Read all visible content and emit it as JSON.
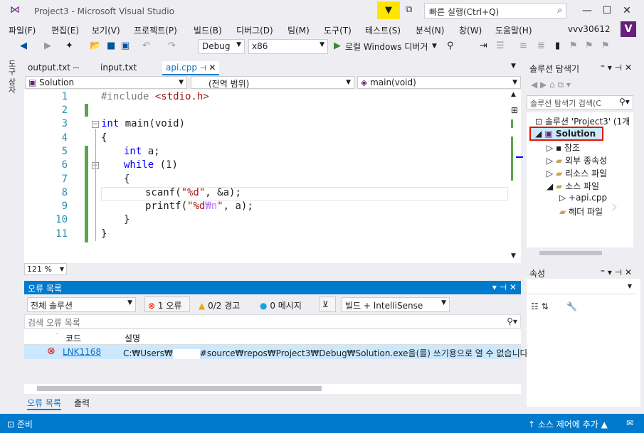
{
  "window": {
    "title": "Project3 - Microsoft Visual Studio",
    "quick_launch_placeholder": "빠른 실행(Ctrl+Q)",
    "account": "vvv30612"
  },
  "menu": [
    "파일(F)",
    "편집(E)",
    "보기(V)",
    "프로젝트(P)",
    "빌드(B)",
    "디버그(D)",
    "팀(M)",
    "도구(T)",
    "테스트(S)",
    "분석(N)",
    "창(W)",
    "도움말(H)"
  ],
  "toolbar": {
    "config": "Debug",
    "platform": "x86",
    "run_label": "로컬 Windows 디버거"
  },
  "sidebar_label": "도구 상자",
  "editor": {
    "tabs": [
      "output.txt",
      "input.txt",
      "api.cpp"
    ],
    "nav_project": "Solution",
    "nav_scope": "(전역 범위)",
    "nav_member": "main(void)",
    "zoom": "121 %",
    "line_numbers": [
      "1",
      "2",
      "3",
      "4",
      "5",
      "6",
      "7",
      "8",
      "9",
      "10",
      "11"
    ],
    "code": {
      "l1_pp": "#include ",
      "l1_hdr": "<stdio.h>",
      "l3_kw": "int",
      "l3_rest": " main(void)",
      "l4": "{",
      "l5_kw": "int",
      "l5_rest": " a;",
      "l6_kw": "while",
      "l6_rest": " (1)",
      "l7": "{",
      "l8_pre": "scanf(",
      "l8_str": "\"%d\"",
      "l8_post": ", &a);",
      "l9_pre": "printf(",
      "l9_str1": "\"%d",
      "l9_esc": "₩n",
      "l9_str2": "\"",
      "l9_post": ", a);",
      "l10": "}",
      "l11": "}"
    }
  },
  "error_list": {
    "title": "오류 목록",
    "scope": "전체 솔루션",
    "errors_btn": "1 오류",
    "warnings_btn": "0/2 경고",
    "messages_btn": "0 메시지",
    "build_filter": "빌드 + IntelliSense",
    "search_placeholder": "검색 오류 목록",
    "col_code": "코드",
    "col_desc": "설명",
    "row_code": "LNK1168",
    "row_desc_a": "C:₩Users₩",
    "row_desc_b": "#source₩repos₩Project3₩Debug₩Solution.exe을(를) 쓰기용으로 열 수 없습니다.",
    "bottom_tabs": [
      "오류 목록",
      "출력"
    ]
  },
  "solution_explorer": {
    "title": "솔루션 탐색기",
    "search_placeholder": "솔루션 탐색기 검색(C",
    "items": [
      "솔루션 'Project3' (1개",
      "Solution",
      "참조",
      "외부 종속성",
      "리소스 파일",
      "소스 파일",
      "api.cpp",
      "헤더 파일"
    ]
  },
  "properties": {
    "title": "속성"
  },
  "status": {
    "left": "준비",
    "right": "소스 제어에 추가"
  },
  "colors": {
    "accent": "#007acc",
    "vs_purple": "#68217a",
    "error_red": "#e51400",
    "change_green": "#57a64a"
  }
}
